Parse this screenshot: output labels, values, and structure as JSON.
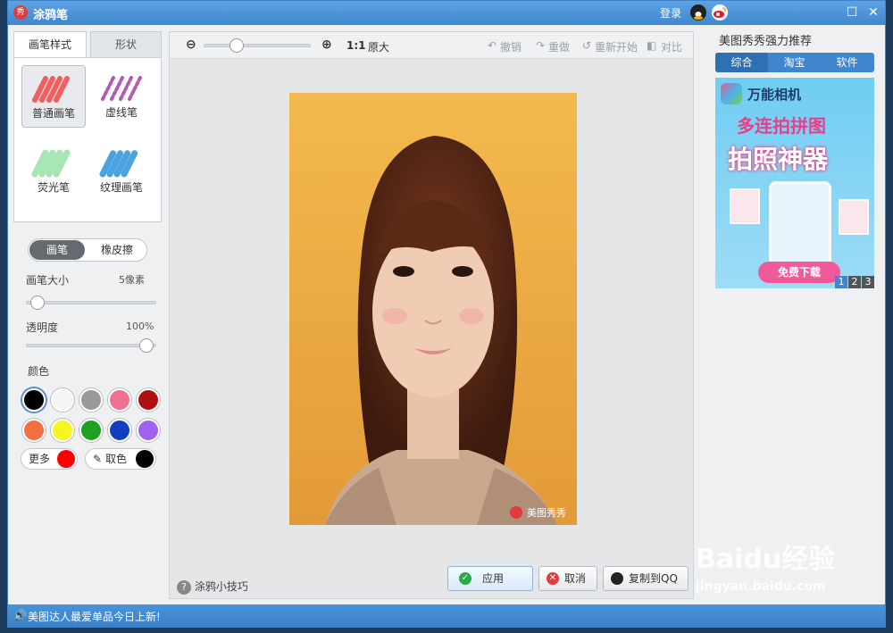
{
  "window": {
    "title": "涂鸦笔",
    "login_label": "登录",
    "colors": {
      "titlebar": "#3f86cf",
      "accent": "#2f6fb3"
    }
  },
  "left": {
    "tabs": [
      "画笔样式",
      "形状"
    ],
    "brushes": [
      {
        "label": "普通画笔",
        "icon": "normal-brush-icon",
        "color": "#f06060"
      },
      {
        "label": "虚线笔",
        "icon": "dashed-brush-icon",
        "color": "#b659b3"
      },
      {
        "label": "荧光笔",
        "icon": "highlighter-icon",
        "color": "#8fe0a0"
      },
      {
        "label": "纹理画笔",
        "icon": "texture-brush-icon",
        "color": "#4aa3e0"
      }
    ],
    "mode": {
      "brush": "画笔",
      "eraser": "橡皮擦"
    },
    "size": {
      "label": "画笔大小",
      "value": "5像素"
    },
    "opacity": {
      "label": "透明度",
      "value": "100%",
      "level": 1.0
    },
    "color_label": "颜色",
    "swatches": [
      "#000000",
      "#f5f5f5",
      "#999999",
      "#f07090",
      "#b01010",
      "#f07040",
      "#f5f520",
      "#20a020",
      "#1040c0",
      "#a060f0"
    ],
    "more_label": "更多",
    "more_color": "#ff0000",
    "pick_label": "取色",
    "pick_color": "#000000"
  },
  "toolbar": {
    "zoom": "1:1",
    "original": "原大",
    "undo": "撤销",
    "redo": "重做",
    "restart": "重新开始",
    "compare": "对比"
  },
  "canvas": {
    "watermark": "美图秀秀",
    "tips": "涂鸦小技巧",
    "apply": "应用",
    "cancel": "取消",
    "copy_qq": "复制到QQ"
  },
  "right": {
    "title": "美图秀秀强力推荐",
    "tabs": [
      "综合",
      "淘宝",
      "软件"
    ],
    "ad": {
      "app_name": "万能相机",
      "headline1": "多连拍拼图",
      "headline2": "拍照神器",
      "cta": "免费下载",
      "pages": [
        "1",
        "2",
        "3"
      ]
    }
  },
  "status": {
    "text": "美图达人最爱单品今日上新!"
  },
  "overlay": {
    "watermark": "Baidu经验",
    "url": "jingyan.baidu.com"
  }
}
